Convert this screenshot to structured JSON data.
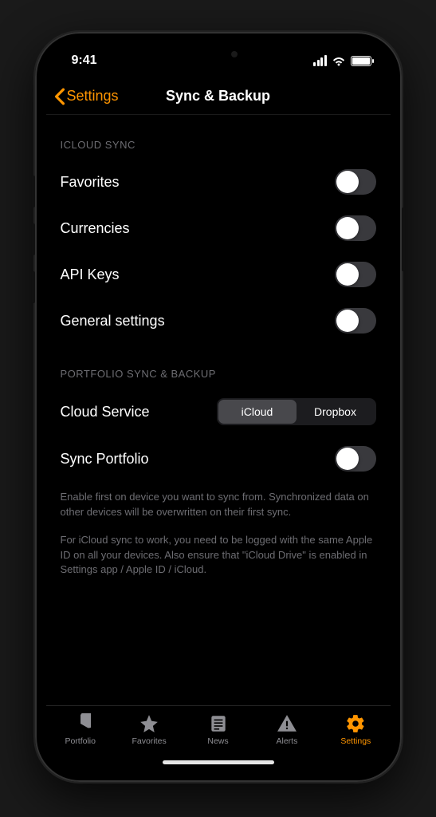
{
  "status": {
    "time": "9:41"
  },
  "nav": {
    "back_label": "Settings",
    "title": "Sync & Backup"
  },
  "sections": {
    "icloud": {
      "header": "ICLOUD SYNC",
      "rows": {
        "favorites": "Favorites",
        "currencies": "Currencies",
        "api_keys": "API Keys",
        "general": "General settings"
      }
    },
    "portfolio": {
      "header": "PORTFOLIO SYNC & BACKUP",
      "cloud_service_label": "Cloud Service",
      "options": {
        "icloud": "iCloud",
        "dropbox": "Dropbox"
      },
      "sync_portfolio_label": "Sync Portfolio",
      "footer1": "Enable first on device you want to sync from. Synchronized data on other devices will be overwritten on their first sync.",
      "footer2": "For iCloud sync to work, you need to be logged with the same Apple ID on all your devices. Also ensure that \"iCloud Drive\" is enabled in Settings app / Apple ID / iCloud."
    }
  },
  "tabs": {
    "portfolio": "Portfolio",
    "favorites": "Favorites",
    "news": "News",
    "alerts": "Alerts",
    "settings": "Settings"
  }
}
